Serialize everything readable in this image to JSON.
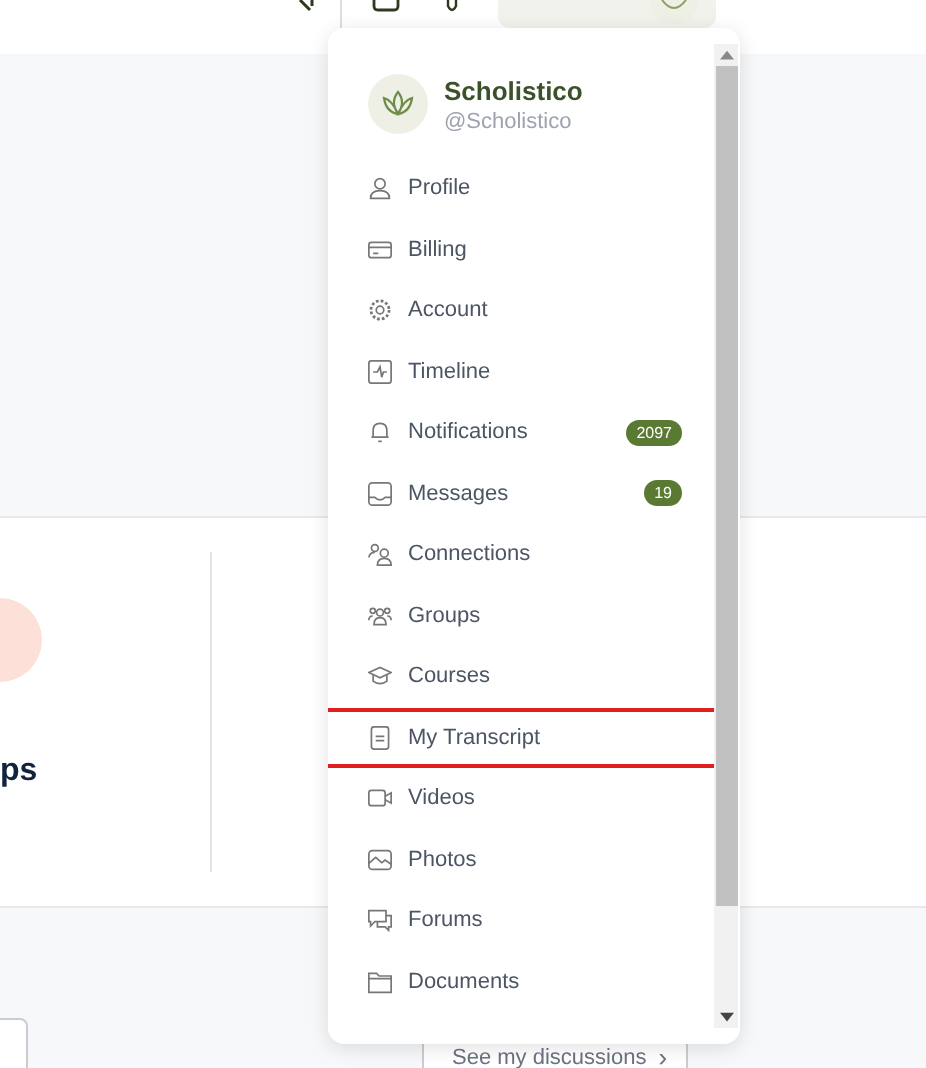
{
  "background_card": {
    "title_fragment": "ps"
  },
  "discussions_button": {
    "label": "See my discussions",
    "chevron": "›"
  },
  "account_menu": {
    "name": "Scholistico",
    "handle": "@Scholistico",
    "items": [
      {
        "label": "Profile",
        "highlighted": false
      },
      {
        "label": "Billing",
        "highlighted": false
      },
      {
        "label": "Account",
        "highlighted": false
      },
      {
        "label": "Timeline",
        "highlighted": false
      },
      {
        "label": "Notifications",
        "badge": "2097",
        "highlighted": false
      },
      {
        "label": "Messages",
        "badge": "19",
        "highlighted": false
      },
      {
        "label": "Connections",
        "highlighted": false
      },
      {
        "label": "Groups",
        "highlighted": false
      },
      {
        "label": "Courses",
        "highlighted": false
      },
      {
        "label": "My Transcript",
        "highlighted": true
      },
      {
        "label": "Videos",
        "highlighted": false
      },
      {
        "label": "Photos",
        "highlighted": false
      },
      {
        "label": "Forums",
        "highlighted": false
      },
      {
        "label": "Documents",
        "highlighted": false
      }
    ]
  }
}
